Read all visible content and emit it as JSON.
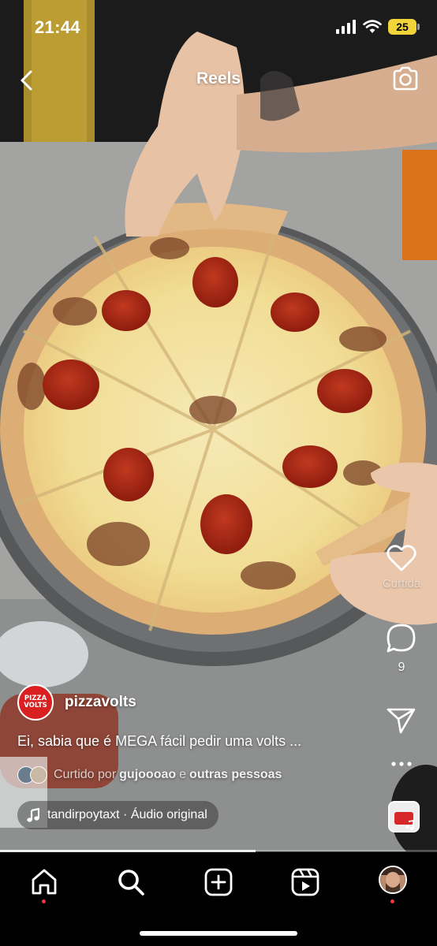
{
  "status_bar": {
    "time": "21:44",
    "battery": "25"
  },
  "header": {
    "title": "Reels"
  },
  "actions": {
    "like_label": "Curtida",
    "comment_count": "9"
  },
  "post": {
    "author": "pizzavolts",
    "avatar_text": [
      "PIZZA",
      "VOLTS"
    ],
    "caption": "Ei, sabia que é MEGA fácil pedir uma volts ...",
    "liked_prefix": "Curtido por",
    "liked_user": "gujoooao",
    "liked_conj": "e",
    "liked_others": "outras pessoas",
    "audio": "tandirpoytaxt · Áudio original"
  },
  "playback": {
    "progress": 0.585
  },
  "tabbar": {
    "items": [
      "home",
      "search",
      "create",
      "reels",
      "profile"
    ]
  },
  "colors": {
    "accent": "#ff3040",
    "battery": "#f1d43a"
  }
}
